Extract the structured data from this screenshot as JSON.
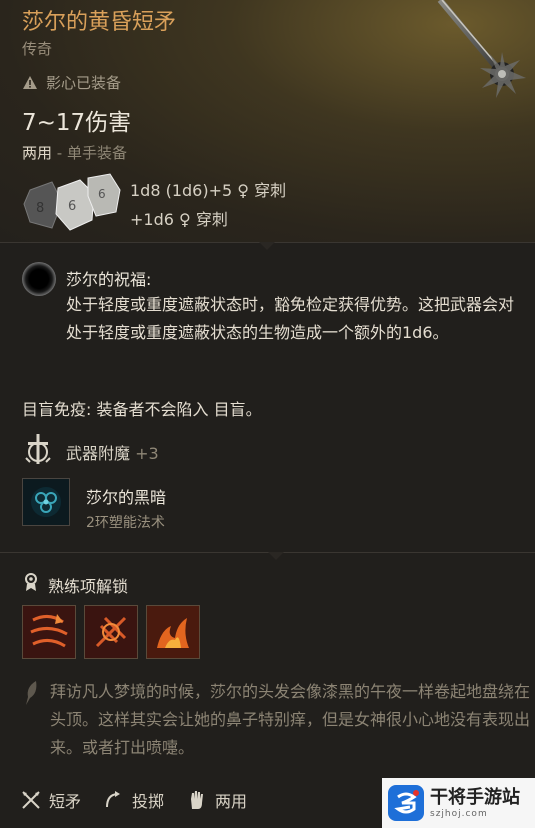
{
  "item": {
    "title": "莎尔的黄昏短矛",
    "rarity": "传奇",
    "equipped": "影心已装备",
    "damage": "7~17伤害",
    "handed_a": "两用",
    "handed_b": " - 单手装备",
    "damage_line1": "1d8 (1d6)+5 ♀ 穿刺",
    "damage_line2": "+1d6 ♀ 穿刺",
    "dice_values": [
      "8",
      "6",
      "6"
    ]
  },
  "blessing": {
    "title": "莎尔的祝福:",
    "text": "处于轻度或重度遮蔽状态时，豁免检定获得优势。这把武器会对处于轻度或重度遮蔽状态的生物造成一个额外的1d6。"
  },
  "blind_immunity": "目盲免疫: 装备者不会陷入 目盲。",
  "enchant": {
    "label": "武器附魔",
    "value": "+3"
  },
  "spell": {
    "name": "莎尔的黑暗",
    "level": "2环塑能法术"
  },
  "proficiency": {
    "title": "熟练项解锁",
    "actions": [
      {
        "name": "action-1",
        "color": "#c0451f"
      },
      {
        "name": "action-2",
        "color": "#b8401c"
      },
      {
        "name": "action-3",
        "color": "#d1561e"
      }
    ]
  },
  "lore": "拜访凡人梦境的时候，莎尔的头发会像漆黑的午夜一样卷起地盘绕在头顶。这样其实会让她的鼻子特别痒，但是女神很小心地没有表现出来。或者打出喷嚏。",
  "footer": {
    "type": "短矛",
    "throw": "投掷",
    "versatile": "两用"
  },
  "watermark": {
    "title": "干将手游站",
    "url": "szjhoj.com"
  }
}
